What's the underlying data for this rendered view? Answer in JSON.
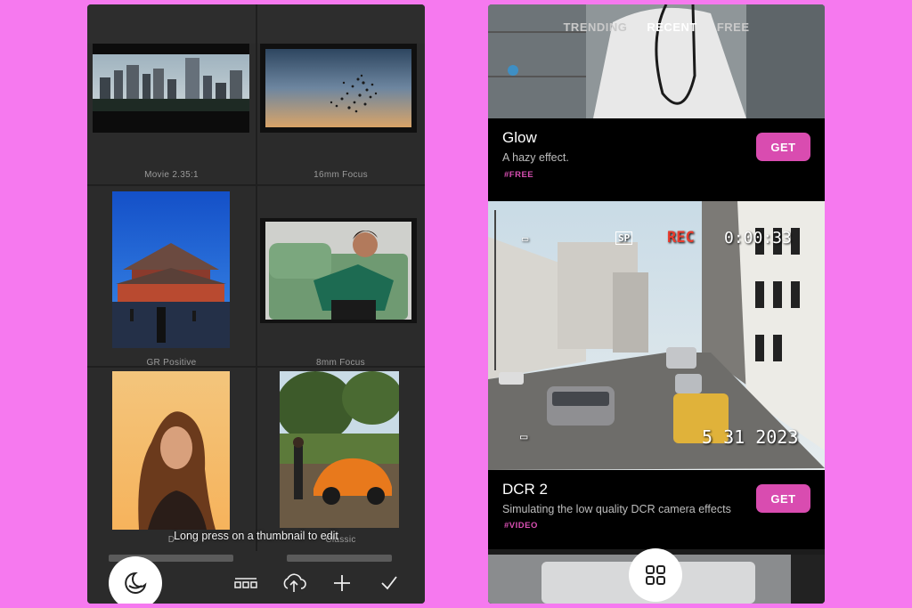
{
  "left_screen": {
    "thumbnails": [
      {
        "caption": "Movie 2.35:1",
        "scene": "city-skyline"
      },
      {
        "caption": "16mm Focus",
        "scene": "birds-sunset"
      },
      {
        "caption": "GR Positive",
        "scene": "temple"
      },
      {
        "caption": "8mm Focus",
        "scene": "man-on-couch"
      },
      {
        "caption": "D",
        "scene": "woman-portrait"
      },
      {
        "caption": "Classic",
        "scene": "orange-beetle"
      }
    ],
    "hint": "Long press on a thumbnail to edit",
    "toolbar": {
      "effects_icon": "moon-filter-icon",
      "icons": [
        "film-strip-icon",
        "cloud-upload-icon",
        "plus-icon",
        "check-icon"
      ]
    }
  },
  "right_screen": {
    "tabs": [
      "TRENDING",
      "RECENT",
      "FREE"
    ],
    "active_tab": "RECENT",
    "effects": [
      {
        "title": "Glow",
        "description": "A hazy effect.",
        "tag": "#FREE",
        "button": "GET"
      },
      {
        "title": "DCR 2",
        "description": "Simulating the low quality DCR camera effects",
        "tag": "#VIDEO",
        "button": "GET"
      }
    ],
    "dcr_overlay": {
      "rec": "REC",
      "timecode": "0:00:33",
      "date": "5 31 2023",
      "mode": "SP"
    },
    "fab_icon": "grid-icon"
  },
  "colors": {
    "page_bg": "#f679ef",
    "accent": "#d94cb0",
    "left_bg": "#2b2b2b",
    "right_bg": "#000000"
  }
}
